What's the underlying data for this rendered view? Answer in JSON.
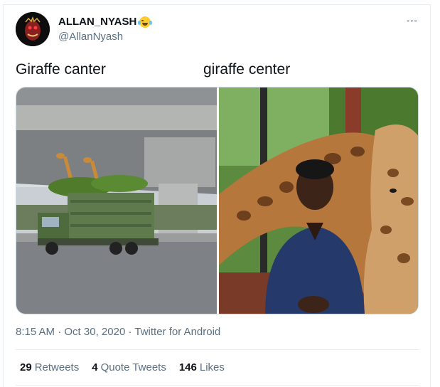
{
  "tweet": {
    "display_name": "ALLAN_NYASH",
    "handle": "@AllanNyash",
    "more_icon": "◦◦◦",
    "caption_left": "Giraffe canter",
    "caption_right": "giraffe center",
    "time": "8:15 AM",
    "separator": "·",
    "date": "Oct 30, 2020",
    "source": "Twitter for Android"
  },
  "stats": {
    "retweets_count": "29",
    "retweets_label": "Retweets",
    "quotes_count": "4",
    "quotes_label": "Quote Tweets",
    "likes_count": "146",
    "likes_label": "Likes"
  },
  "icons": [
    "avatar-image",
    "laughing-emoji-icon",
    "more-options-icon"
  ]
}
